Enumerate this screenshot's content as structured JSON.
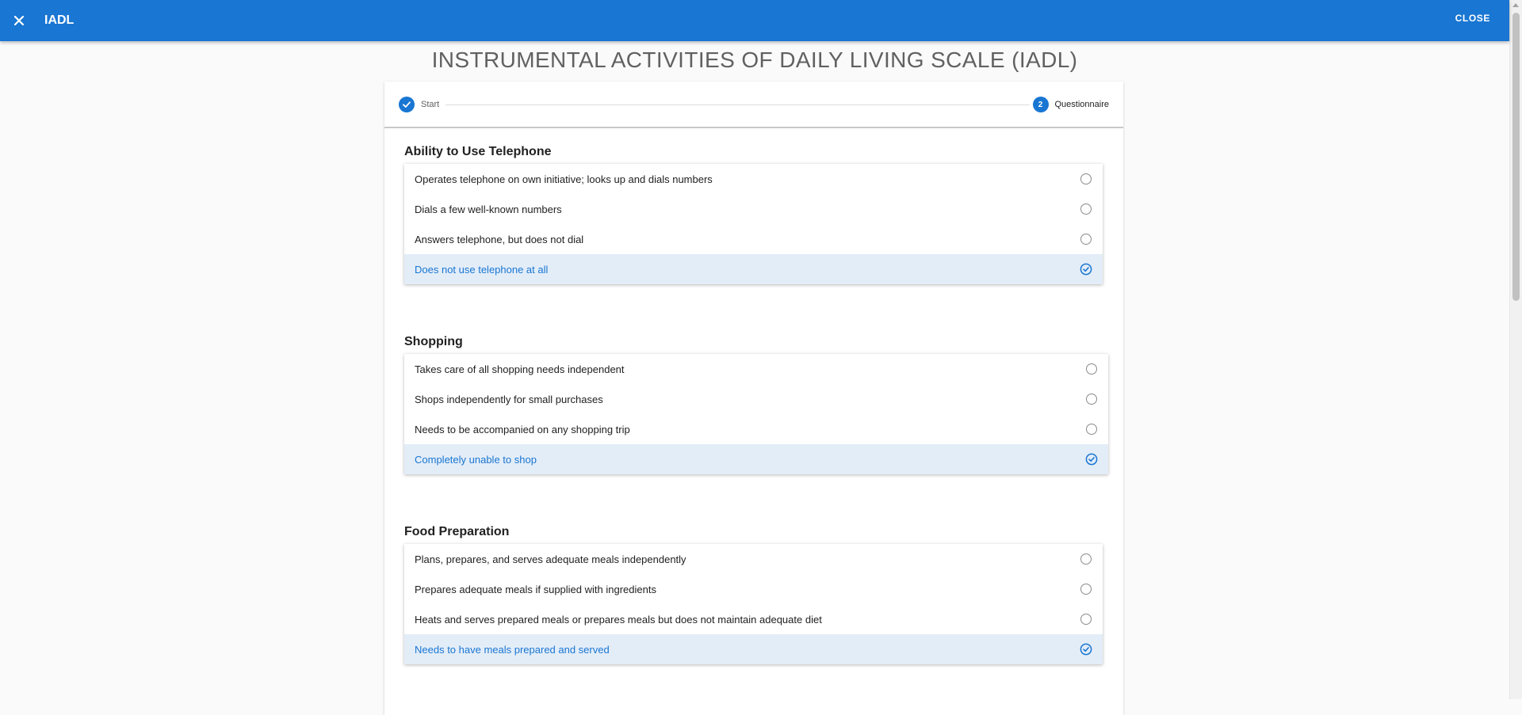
{
  "header": {
    "title": "IADL",
    "close_label": "CLOSE"
  },
  "page_title": "INSTRUMENTAL ACTIVITIES OF DAILY LIVING SCALE (IADL)",
  "stepper": {
    "steps": [
      {
        "label": "Start",
        "state": "completed"
      },
      {
        "number": "2",
        "label": "Questionnaire",
        "state": "active"
      }
    ]
  },
  "sections": [
    {
      "title": "Ability to Use Telephone",
      "options": [
        "Operates telephone on own initiative; looks up and dials numbers",
        "Dials a few well-known numbers",
        "Answers telephone, but does not dial",
        "Does not use telephone at all"
      ],
      "selected_index": 3
    },
    {
      "title": "Shopping",
      "options": [
        "Takes care of all shopping needs independent",
        "Shops independently for small purchases",
        "Needs to be accompanied on any shopping trip",
        "Completely unable to shop"
      ],
      "selected_index": 3
    },
    {
      "title": "Food Preparation",
      "options": [
        "Plans, prepares, and serves adequate meals independently",
        "Prepares adequate meals if supplied with ingredients",
        "Heats and serves prepared meals or prepares meals but does not maintain adequate diet",
        "Needs to have meals prepared and served"
      ],
      "selected_index": 3
    }
  ],
  "colors": {
    "primary": "#1976d2",
    "selected_bg": "#e3edf8"
  },
  "icons": [
    "close-icon",
    "check-icon",
    "radio-checked-icon"
  ]
}
